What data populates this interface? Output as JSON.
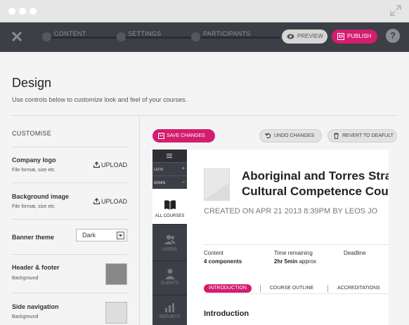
{
  "topbar": {
    "steps": [
      "CONTENT",
      "SETTINGS",
      "PARTICIPANTS"
    ],
    "preview_label": "PREVIEW",
    "publish_label": "PUBLISH",
    "help_label": "?"
  },
  "page": {
    "title": "Design",
    "subtitle": "Use controls below to customize look and feel of your courses."
  },
  "customise": {
    "heading": "CUSTOMISE",
    "company_logo": {
      "label": "Company logo",
      "hint": "File format, size etc",
      "upload_label": "UPLOAD"
    },
    "background_image": {
      "label": "Background image",
      "hint": "File format, size etc",
      "upload_label": "UPLOAD"
    },
    "banner_theme": {
      "label": "Banner theme",
      "selected": "Dark"
    },
    "header_footer": {
      "label": "Header & footer",
      "hint": "Background",
      "color": "#888888"
    },
    "side_navigation": {
      "label": "Side navigation",
      "hint": "Background",
      "color": "#dddddd"
    }
  },
  "actions": {
    "save_label": "SAVE CHANGES",
    "undo_label": "UNDO CHANGES",
    "revert_label": "REVERT TO DEAFULT"
  },
  "preview": {
    "tags": [
      "LEOS",
      "ADMIN"
    ],
    "nav": [
      "ALL COURSES",
      "USERS",
      "CLIENTS",
      "REPORTS"
    ],
    "course_title_line1": "Aboriginal and Torres Stra",
    "course_title_line2": "Cultural Competence Cou",
    "created": "CREATED ON APR 21 2013 8:39PM BY LEOS JO",
    "meta": {
      "content_label": "Content",
      "content_value": "4 components",
      "time_label": "Time remaining",
      "time_value_bold": "2hr 5min",
      "time_value_rest": " approx",
      "deadline_label": "Deadline"
    },
    "tabs": [
      "INTRODUCTION",
      "COURSE OUTLINE",
      "ACCREDITATIONS"
    ],
    "section_heading": "Introduction"
  },
  "colors": {
    "accent": "#d41d6f",
    "topbar": "#3c3f45"
  }
}
